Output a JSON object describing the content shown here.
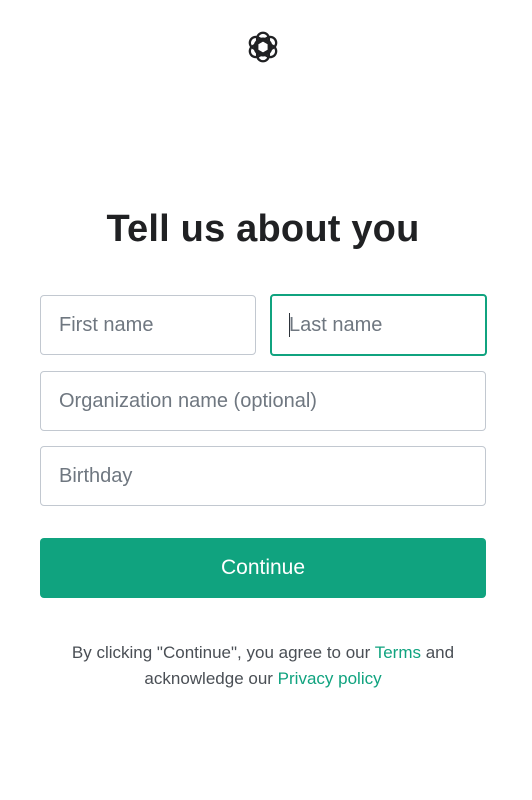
{
  "logo": {
    "icon": "openai-logo-icon"
  },
  "heading": "Tell us about you",
  "form": {
    "first_name": {
      "placeholder": "First name",
      "value": ""
    },
    "last_name": {
      "placeholder": "Last name",
      "value": "",
      "focused": true
    },
    "organization": {
      "placeholder": "Organization name (optional)",
      "value": ""
    },
    "birthday": {
      "placeholder": "Birthday",
      "value": ""
    },
    "continue_label": "Continue"
  },
  "legal": {
    "prefix": "By clicking \"Continue\", you agree to our ",
    "terms_label": "Terms",
    "middle": " and acknowledge our ",
    "privacy_label": "Privacy policy"
  },
  "colors": {
    "accent": "#10a37f",
    "heading": "#202123",
    "border": "#c2c8d0",
    "placeholder": "#6f7780"
  }
}
